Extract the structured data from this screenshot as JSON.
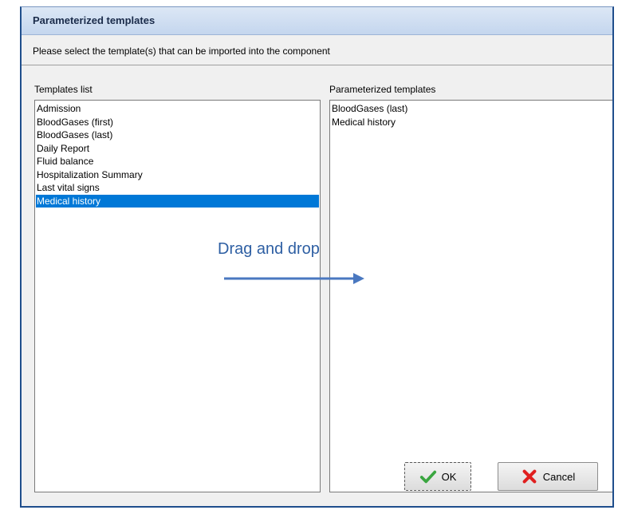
{
  "dialog": {
    "title": "Parameterized templates",
    "instruction": "Please select the template(s) that can be imported into the component"
  },
  "left_panel": {
    "label": "Templates list",
    "items": [
      "Admission",
      "BloodGases (first)",
      "BloodGases (last)",
      "Daily Report",
      "Fluid balance",
      "Hospitalization Summary",
      "Last vital signs",
      "Medical history"
    ],
    "selected": "Medical history"
  },
  "right_panel": {
    "label": "Parameterized templates",
    "items": [
      "BloodGases (last)",
      "Medical history"
    ]
  },
  "annotation": {
    "text": "Drag and drop",
    "color": "#2e5fa3"
  },
  "buttons": {
    "ok": {
      "label": "OK",
      "icon": "checkmark-icon",
      "color": "#3aa640"
    },
    "cancel": {
      "label": "Cancel",
      "icon": "x-icon",
      "color": "#e02020"
    }
  },
  "colors": {
    "selection": "#0078d7",
    "titlebar": "#c4d6ee"
  }
}
